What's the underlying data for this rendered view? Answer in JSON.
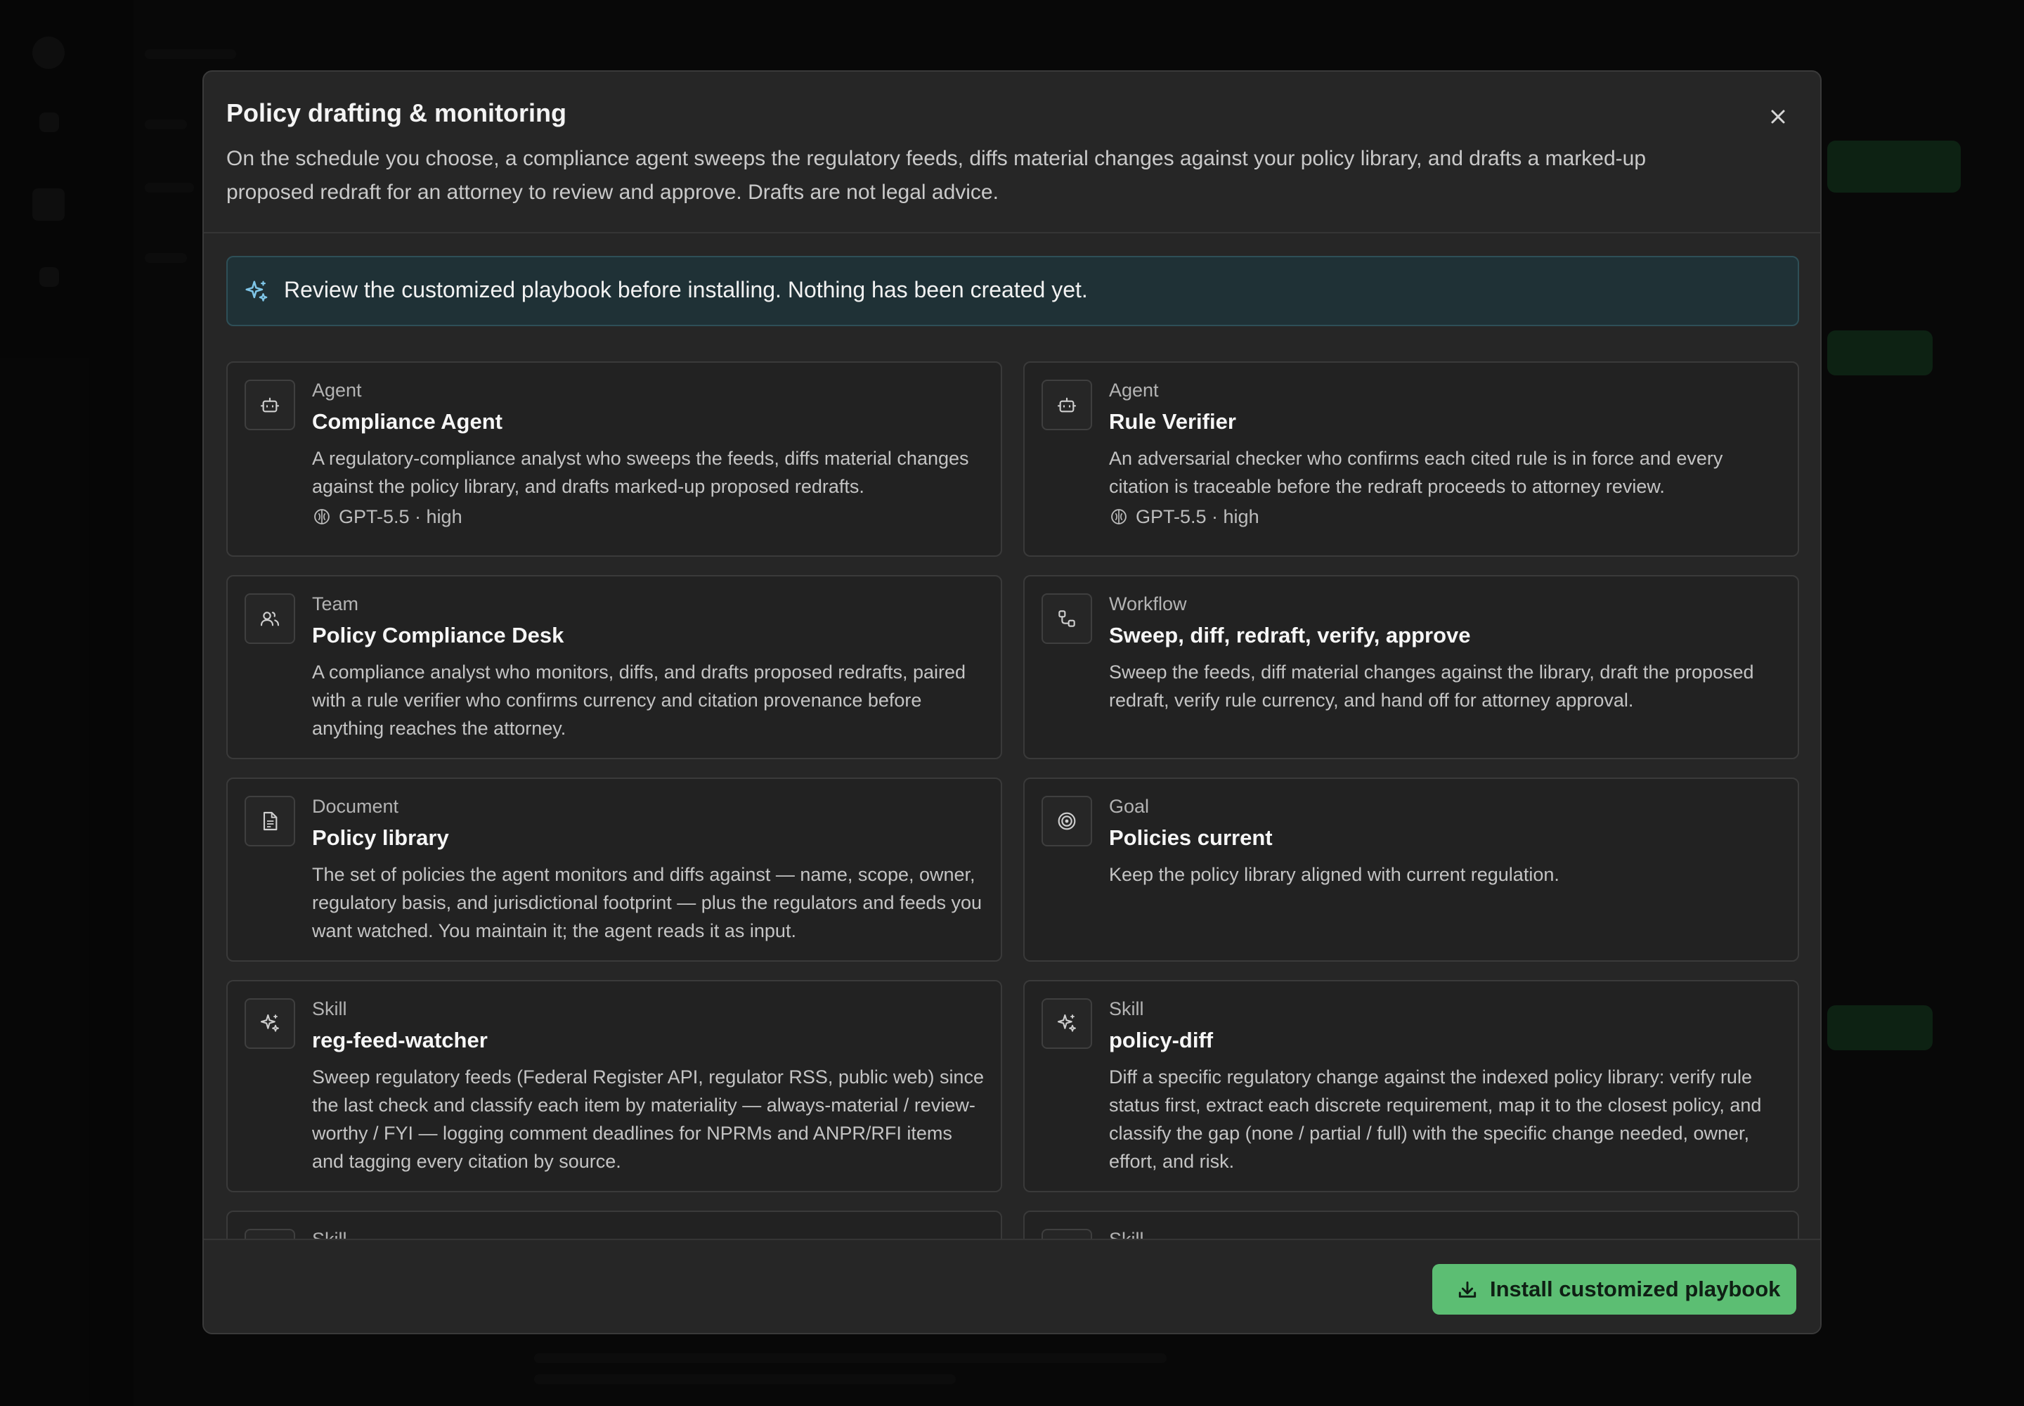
{
  "modal": {
    "title": "Policy drafting & monitoring",
    "description": "On the schedule you choose, a compliance agent sweeps the regulatory feeds, diffs material changes against your policy library, and drafts a marked-up proposed redraft for an attorney to review and approve. Drafts are not legal advice.",
    "close_icon": "close-icon"
  },
  "notice": {
    "icon": "sparkle-icon",
    "text": "Review the customized playbook before installing. Nothing has been created yet."
  },
  "cards": [
    {
      "kind": "Agent",
      "icon": "robot-icon",
      "title": "Compliance Agent",
      "description": "A regulatory-compliance analyst who sweeps the feeds, diffs material changes against the policy library, and drafts marked-up proposed redrafts.",
      "meta": "GPT-5.5 · high"
    },
    {
      "kind": "Agent",
      "icon": "robot-icon",
      "title": "Rule Verifier",
      "description": "An adversarial checker who confirms each cited rule is in force and every citation is traceable before the redraft proceeds to attorney review.",
      "meta": "GPT-5.5 · high"
    },
    {
      "kind": "Team",
      "icon": "users-icon",
      "title": "Policy Compliance Desk",
      "description": "A compliance analyst who monitors, diffs, and drafts proposed redrafts, paired with a rule verifier who confirms currency and citation provenance before anything reaches the attorney."
    },
    {
      "kind": "Workflow",
      "icon": "workflow-icon",
      "title": "Sweep, diff, redraft, verify, approve",
      "description": "Sweep the feeds, diff material changes against the library, draft the proposed redraft, verify rule currency, and hand off for attorney approval."
    },
    {
      "kind": "Document",
      "icon": "document-icon",
      "title": "Policy library",
      "description": "The set of policies the agent monitors and diffs against — name, scope, owner, regulatory basis, and jurisdictional footprint — plus the regulators and feeds you want watched. You maintain it; the agent reads it as input."
    },
    {
      "kind": "Goal",
      "icon": "target-icon",
      "title": "Policies current",
      "description": "Keep the policy library aligned with current regulation."
    },
    {
      "kind": "Skill",
      "icon": "sparkle-icon",
      "title": "reg-feed-watcher",
      "description": "Sweep regulatory feeds (Federal Register API, regulator RSS, public web) since the last check and classify each item by materiality — always-material / review-worthy / FYI — logging comment deadlines for NPRMs and ANPR/RFI items and tagging every citation by source."
    },
    {
      "kind": "Skill",
      "icon": "sparkle-icon",
      "title": "policy-diff",
      "description": "Diff a specific regulatory change against the indexed policy library: verify rule status first, extract each discrete requirement, map it to the closest policy, and classify the gap (none / partial / full) with the specific change needed, owner, effort, and risk."
    },
    {
      "kind": "Skill",
      "icon": "sparkle-icon",
      "title": "",
      "description": ""
    },
    {
      "kind": "Skill",
      "icon": "sparkle-icon",
      "title": "",
      "description": ""
    }
  ],
  "footer": {
    "install_label": "Install customized playbook",
    "install_icon": "download-icon"
  },
  "colors": {
    "accent_green": "#5cbe73",
    "notice_bg": "#1f3136",
    "notice_icon": "#7fc6e8",
    "modal_bg": "#262626"
  }
}
